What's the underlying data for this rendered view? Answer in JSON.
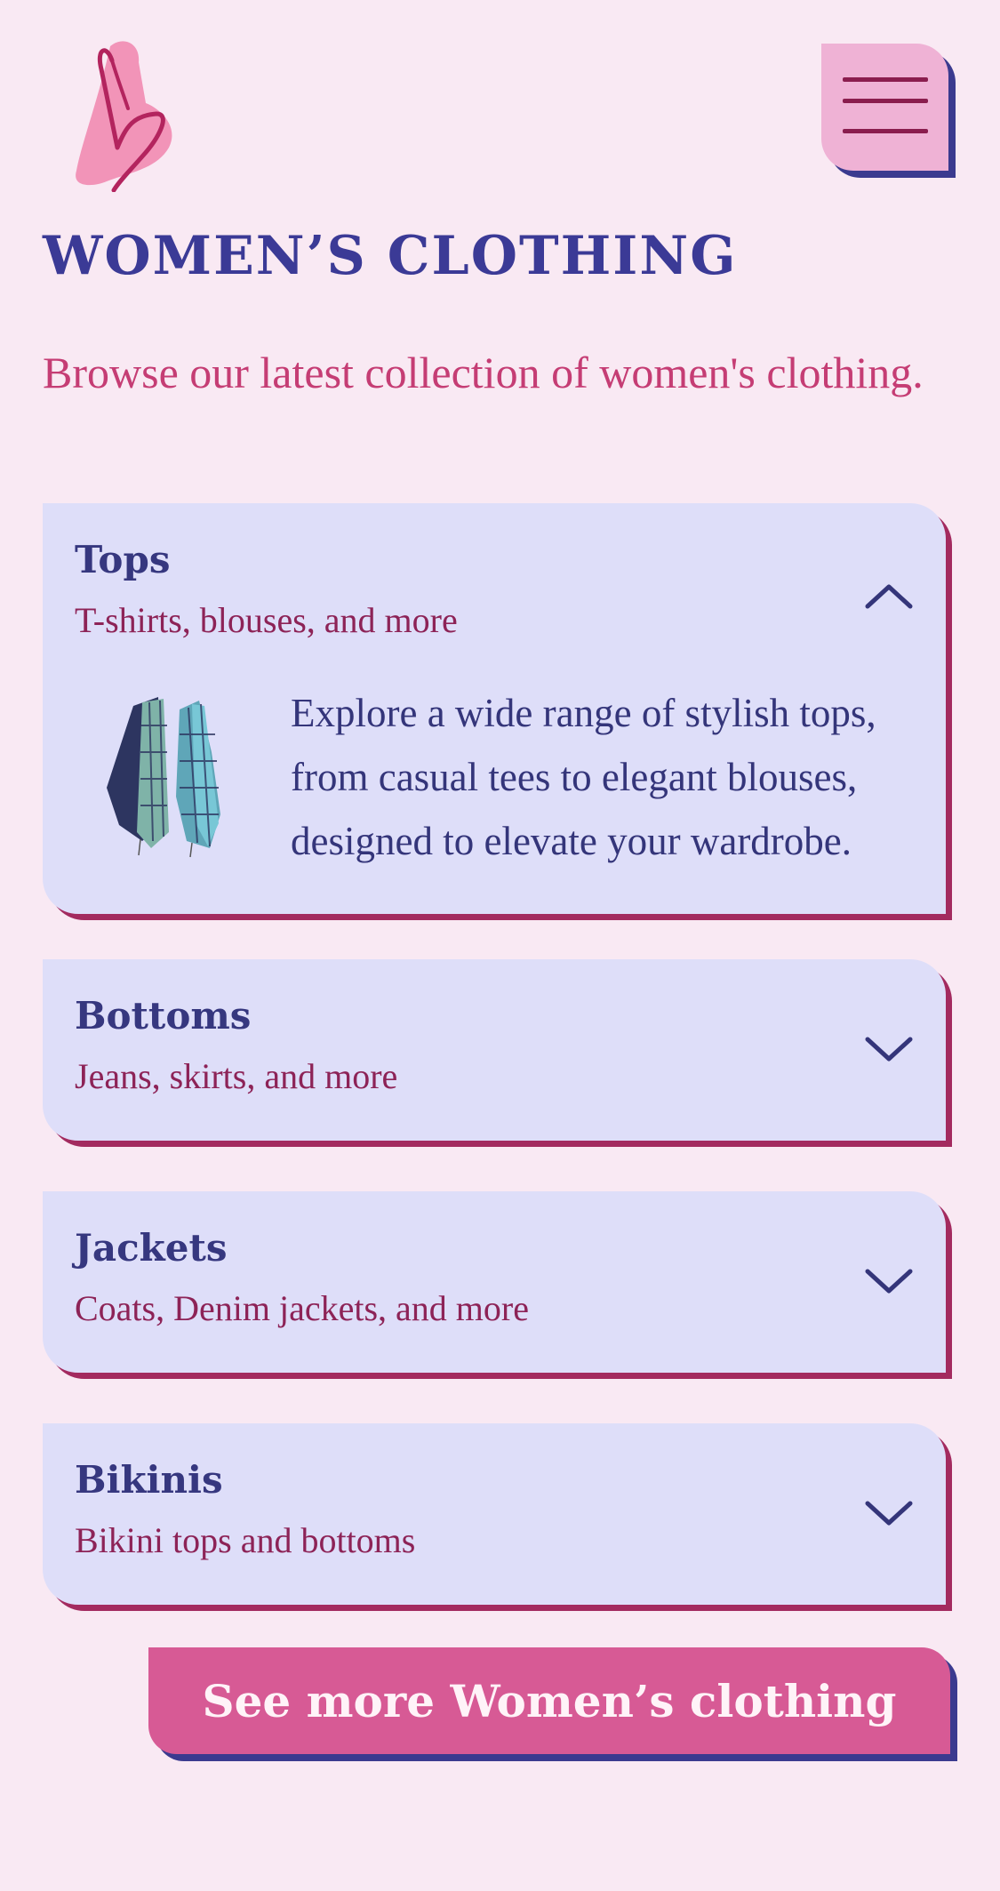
{
  "header": {
    "logo_icon": "heart-scribble-logo",
    "menu_icon": "hamburger-menu-icon"
  },
  "page": {
    "title": "WOMEN’S CLOTHING",
    "intro": "Browse our latest collection of women's clothing."
  },
  "categories": [
    {
      "title": "Tops",
      "subtitle": "T-shirts, blouses, and more",
      "expanded": true,
      "chevron_icon": "chevron-up-icon",
      "body_text": "Explore a wide range of stylish tops, from casual tees to elegant blouses, designed to elevate your wardrobe."
    },
    {
      "title": "Bottoms",
      "subtitle": "Jeans, skirts, and more",
      "expanded": false,
      "chevron_icon": "chevron-down-icon"
    },
    {
      "title": "Jackets",
      "subtitle": "Coats, Denim jackets, and more",
      "expanded": false,
      "chevron_icon": "chevron-down-icon"
    },
    {
      "title": "Bikinis",
      "subtitle": "Bikini tops and bottoms",
      "expanded": false,
      "chevron_icon": "chevron-down-icon"
    }
  ],
  "cta": {
    "label": "See more Women’s clothing"
  },
  "colors": {
    "background": "#f9e9f3",
    "heading": "#3b3a96",
    "accent_pink": "#c53d74",
    "card_bg": "#dedef9",
    "card_shadow": "#a32a5f",
    "button_bg": "#d75a95",
    "menu_bg": "#efb2d5"
  }
}
